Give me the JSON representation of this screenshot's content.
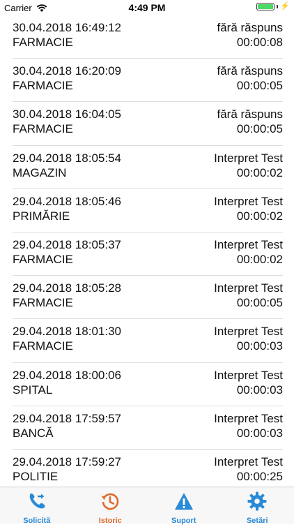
{
  "status_bar": {
    "carrier": "Carrier",
    "time": "4:49 PM"
  },
  "history": [
    {
      "datetime": "30.04.2018 16:49:12",
      "status": "fără răspuns",
      "place": "FARMACIE",
      "duration": "00:00:08"
    },
    {
      "datetime": "30.04.2018 16:20:09",
      "status": "fără răspuns",
      "place": "FARMACIE",
      "duration": "00:00:05"
    },
    {
      "datetime": "30.04.2018 16:04:05",
      "status": "fără răspuns",
      "place": "FARMACIE",
      "duration": "00:00:05"
    },
    {
      "datetime": "29.04.2018 18:05:54",
      "status": "Interpret Test",
      "place": "MAGAZIN",
      "duration": "00:00:02"
    },
    {
      "datetime": "29.04.2018 18:05:46",
      "status": "Interpret Test",
      "place": "PRIMĂRIE",
      "duration": "00:00:02"
    },
    {
      "datetime": "29.04.2018 18:05:37",
      "status": "Interpret Test",
      "place": "FARMACIE",
      "duration": "00:00:02"
    },
    {
      "datetime": "29.04.2018 18:05:28",
      "status": "Interpret Test",
      "place": "FARMACIE",
      "duration": "00:00:05"
    },
    {
      "datetime": "29.04.2018 18:01:30",
      "status": "Interpret Test",
      "place": "FARMACIE",
      "duration": "00:00:03"
    },
    {
      "datetime": "29.04.2018 18:00:06",
      "status": "Interpret Test",
      "place": "SPITAL",
      "duration": "00:00:03"
    },
    {
      "datetime": "29.04.2018 17:59:57",
      "status": "Interpret Test",
      "place": "BANCĂ",
      "duration": "00:00:03"
    },
    {
      "datetime": "29.04.2018 17:59:27",
      "status": "Interpret Test",
      "place": "POLITIE",
      "duration": "00:00:25"
    }
  ],
  "tabs": [
    {
      "label": "Solicită",
      "icon": "phone-forward-icon",
      "active": false
    },
    {
      "label": "Istoric",
      "icon": "history-icon",
      "active": true
    },
    {
      "label": "Suport",
      "icon": "warning-icon",
      "active": false
    },
    {
      "label": "Setări",
      "icon": "gear-icon",
      "active": false
    }
  ],
  "colors": {
    "tab_blue": "#2a8ad6",
    "tab_active": "#e06a2c"
  }
}
